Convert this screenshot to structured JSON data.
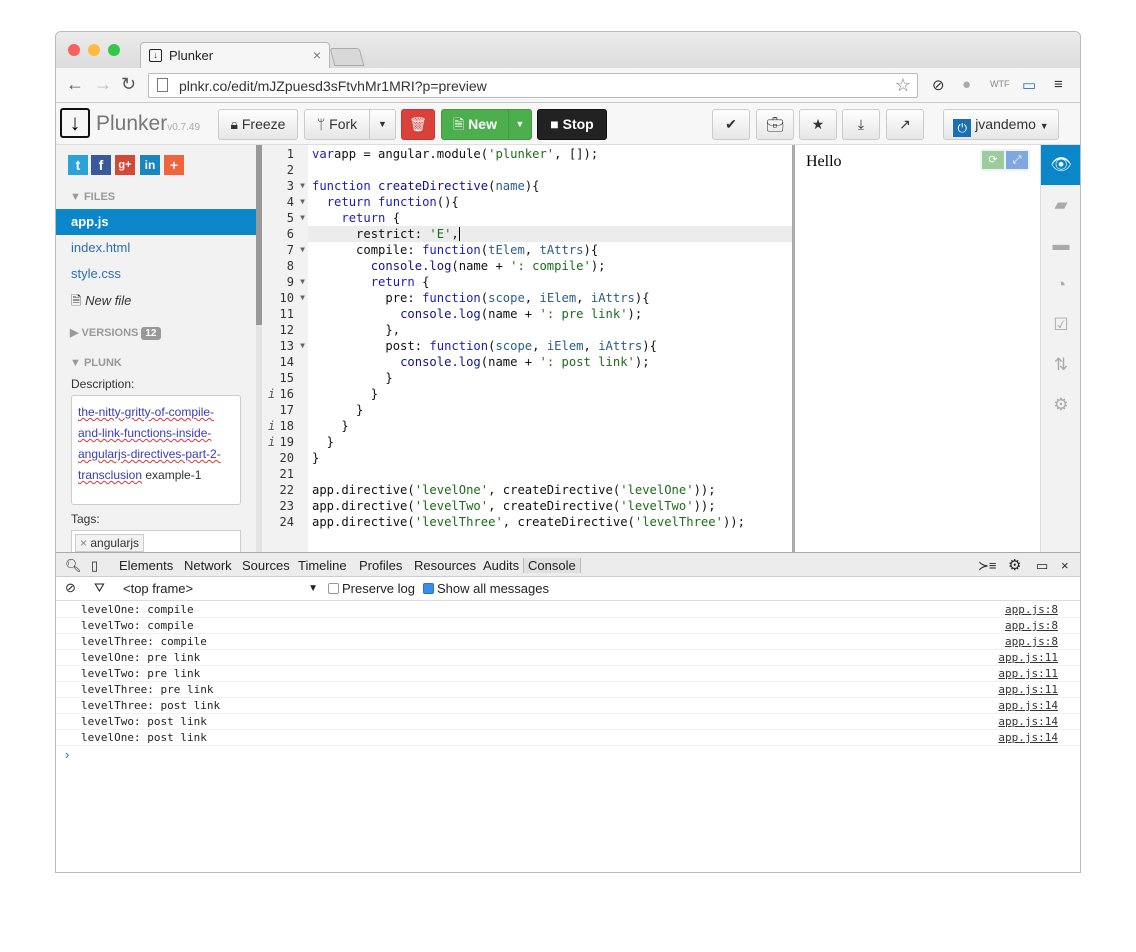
{
  "browser": {
    "tab_title": "Plunker",
    "url": "plnkr.co/edit/mJZpuesd3sFtvhMr1MRI?p=preview"
  },
  "toolbar": {
    "brand": "Plunker",
    "version": "v0.7.49",
    "freeze": "Freeze",
    "fork": "Fork",
    "new": "New",
    "stop": "Stop",
    "user": "jvandemo"
  },
  "sidebar": {
    "files_header": "FILES",
    "files": [
      "app.js",
      "index.html",
      "style.css"
    ],
    "new_file": "New file",
    "versions_header": "VERSIONS",
    "versions_count": "12",
    "plunk_header": "PLUNK",
    "description_label": "Description:",
    "description_misspelled": [
      "the-nitty-gritty-of-compile-",
      "and-link-functions-inside-",
      "angularjs-directives-part-2-",
      "transclusion"
    ],
    "description_rest": " example-1",
    "tags_label": "Tags:",
    "tags": [
      "angularjs"
    ]
  },
  "editor": {
    "active_line": 6,
    "info_lines": [
      16,
      18,
      19
    ],
    "fold_lines": [
      3,
      4,
      5,
      7,
      9,
      10,
      13
    ],
    "lines": [
      [
        [
          "k",
          "var"
        ],
        [
          "",
          "app = angular.module("
        ],
        [
          "s",
          "'plunker'"
        ],
        [
          "",
          ", []);"
        ]
      ],
      [],
      [
        [
          "k",
          "function "
        ],
        [
          "f",
          "createDirective"
        ],
        [
          "",
          "("
        ],
        [
          "p",
          "name"
        ],
        [
          "",
          "){"
        ]
      ],
      [
        [
          "",
          "  "
        ],
        [
          "k",
          "return function"
        ],
        [
          "",
          "(){"
        ]
      ],
      [
        [
          "",
          "    "
        ],
        [
          "k",
          "return"
        ],
        [
          "",
          " {"
        ]
      ],
      [
        [
          "",
          "      restrict: "
        ],
        [
          "s",
          "'E'"
        ],
        [
          "",
          ","
        ]
      ],
      [
        [
          "",
          "      compile: "
        ],
        [
          "k",
          "function"
        ],
        [
          "",
          "("
        ],
        [
          "p",
          "tElem"
        ],
        [
          "",
          ", "
        ],
        [
          "p",
          "tAttrs"
        ],
        [
          "",
          "){"
        ]
      ],
      [
        [
          "",
          "        "
        ],
        [
          "f",
          "console.log"
        ],
        [
          "",
          "(name + "
        ],
        [
          "s",
          "': compile'"
        ],
        [
          "",
          ");"
        ]
      ],
      [
        [
          "",
          "        "
        ],
        [
          "k",
          "return"
        ],
        [
          "",
          " {"
        ]
      ],
      [
        [
          "",
          "          pre: "
        ],
        [
          "k",
          "function"
        ],
        [
          "",
          "("
        ],
        [
          "p",
          "scope"
        ],
        [
          "",
          ", "
        ],
        [
          "p",
          "iElem"
        ],
        [
          "",
          ", "
        ],
        [
          "p",
          "iAttrs"
        ],
        [
          "",
          "){"
        ]
      ],
      [
        [
          "",
          "            "
        ],
        [
          "f",
          "console.log"
        ],
        [
          "",
          "(name + "
        ],
        [
          "s",
          "': pre link'"
        ],
        [
          "",
          ");"
        ]
      ],
      [
        [
          "",
          "          },"
        ]
      ],
      [
        [
          "",
          "          post: "
        ],
        [
          "k",
          "function"
        ],
        [
          "",
          "("
        ],
        [
          "p",
          "scope"
        ],
        [
          "",
          ", "
        ],
        [
          "p",
          "iElem"
        ],
        [
          "",
          ", "
        ],
        [
          "p",
          "iAttrs"
        ],
        [
          "",
          "){"
        ]
      ],
      [
        [
          "",
          "            "
        ],
        [
          "f",
          "console.log"
        ],
        [
          "",
          "(name + "
        ],
        [
          "s",
          "': post link'"
        ],
        [
          "",
          ");"
        ]
      ],
      [
        [
          "",
          "          }"
        ]
      ],
      [
        [
          "",
          "        }"
        ]
      ],
      [
        [
          "",
          "      }"
        ]
      ],
      [
        [
          "",
          "    }"
        ]
      ],
      [
        [
          "",
          "  }"
        ]
      ],
      [
        [
          "",
          "}"
        ]
      ],
      [],
      [
        [
          "",
          "app.directive("
        ],
        [
          "s",
          "'levelOne'"
        ],
        [
          "",
          ", createDirective("
        ],
        [
          "s",
          "'levelOne'"
        ],
        [
          "",
          "));"
        ]
      ],
      [
        [
          "",
          "app.directive("
        ],
        [
          "s",
          "'levelTwo'"
        ],
        [
          "",
          ", createDirective("
        ],
        [
          "s",
          "'levelTwo'"
        ],
        [
          "",
          "));"
        ]
      ],
      [
        [
          "",
          "app.directive("
        ],
        [
          "s",
          "'levelThree'"
        ],
        [
          "",
          ", createDirective("
        ],
        [
          "s",
          "'levelThree'"
        ],
        [
          "",
          "));"
        ]
      ]
    ]
  },
  "preview": {
    "text": "Hello"
  },
  "devtools": {
    "tabs": [
      "Elements",
      "Network",
      "Sources",
      "Timeline",
      "Profiles",
      "Resources",
      "Audits",
      "Console"
    ],
    "active_tab": "Console",
    "frame": "<top frame>",
    "preserve_log": "Preserve log",
    "preserve_checked": false,
    "show_all": "Show all messages",
    "show_all_checked": true,
    "messages": [
      {
        "text": "levelOne: compile",
        "source": "app.js:8"
      },
      {
        "text": "levelTwo: compile",
        "source": "app.js:8"
      },
      {
        "text": "levelThree: compile",
        "source": "app.js:8"
      },
      {
        "text": "levelOne: pre link",
        "source": "app.js:11"
      },
      {
        "text": "levelTwo: pre link",
        "source": "app.js:11"
      },
      {
        "text": "levelThree: pre link",
        "source": "app.js:11"
      },
      {
        "text": "levelThree: post link",
        "source": "app.js:14"
      },
      {
        "text": "levelTwo: post link",
        "source": "app.js:14"
      },
      {
        "text": "levelOne: post link",
        "source": "app.js:14"
      }
    ],
    "prompt": "›"
  },
  "colors": {
    "accent": "#0a86c9",
    "danger": "#d9413a",
    "success": "#4cae4c"
  }
}
